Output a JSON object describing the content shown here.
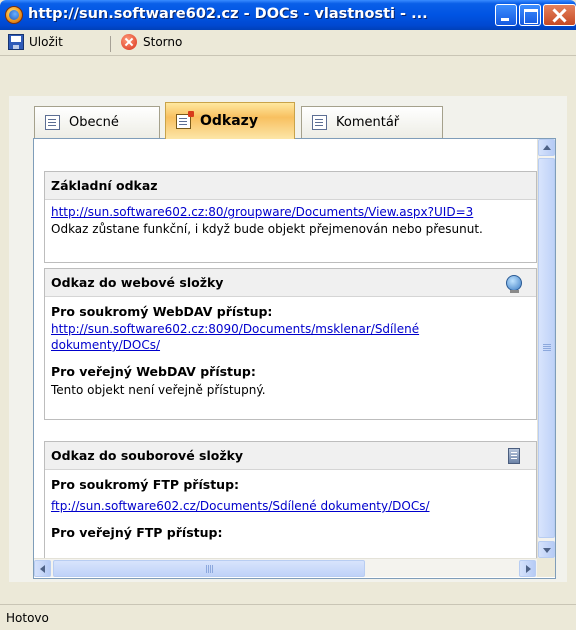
{
  "window": {
    "title": "http://sun.software602.cz - DOCs - vlastnosti - ..."
  },
  "toolbar": {
    "save_label": "Uložit",
    "cancel_label": "Storno"
  },
  "tabs": [
    {
      "label": "Obecné",
      "active": false
    },
    {
      "label": "Odkazy",
      "active": true
    },
    {
      "label": "Komentář",
      "active": false
    }
  ],
  "sections": {
    "basic": {
      "title": "Základní odkaz",
      "link": "http://sun.software602.cz:80/groupware/Documents/View.aspx?UID=3",
      "note": "Odkaz zůstane funkční, i když bude objekt přejmenován nebo přesunut."
    },
    "web": {
      "title": "Odkaz do webové složky",
      "icon": "web-folder-icon",
      "private_label": "Pro soukromý WebDAV přístup:",
      "private_link": "http://sun.software602.cz:8090/Documents/msklenar/Sdílené dokumenty/DOCs/",
      "public_label": "Pro veřejný WebDAV přístup:",
      "public_text": "Tento objekt není veřejně přístupný."
    },
    "file": {
      "title": "Odkaz do souborové složky",
      "icon": "server-icon",
      "private_label": "Pro soukromý FTP přístup:",
      "private_link": "ftp://sun.software602.cz/Documents/Sdílené dokumenty/DOCs/",
      "public_label": "Pro veřejný FTP přístup:"
    }
  },
  "statusbar": {
    "text": "Hotovo"
  },
  "colors": {
    "titlebar": "#0054E3",
    "link": "#0000CC",
    "active_tab": "#F8C060"
  }
}
